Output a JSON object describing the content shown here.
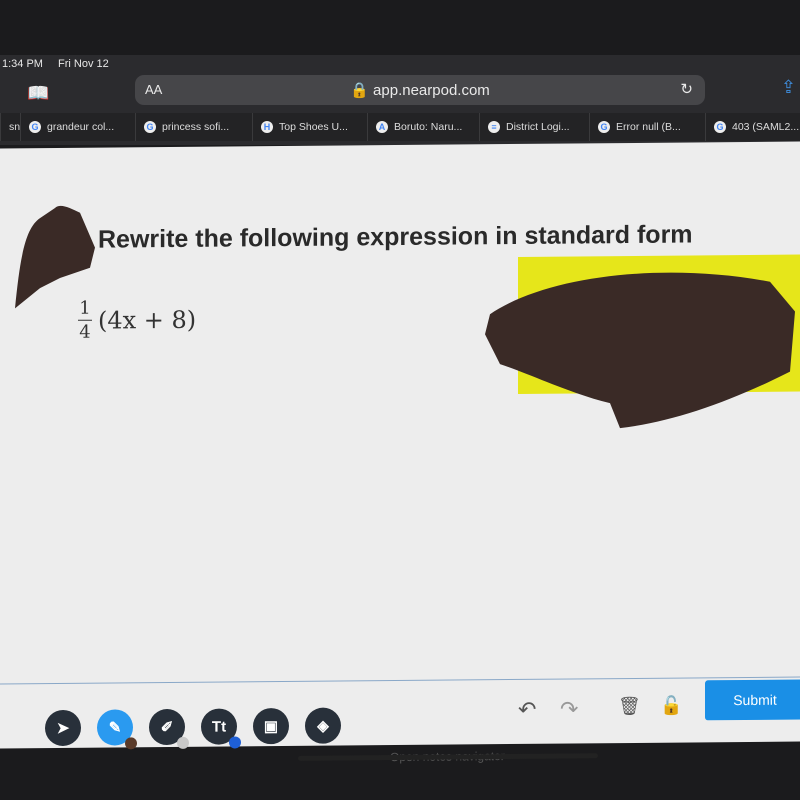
{
  "status_bar": {
    "time": "1:34 PM",
    "date": "Fri Nov 12"
  },
  "browser": {
    "text_size_label": "AA",
    "url": "app.nearpod.com",
    "icons": {
      "bookmarks": "book-icon",
      "lock": "lock-icon",
      "reload": "reload-icon",
      "share": "share-icon"
    },
    "tabs": [
      {
        "label": "sn",
        "icon": ""
      },
      {
        "label": "grandeur col...",
        "icon": "G"
      },
      {
        "label": "princess sofi...",
        "icon": "G"
      },
      {
        "label": "Top Shoes U...",
        "icon": "H"
      },
      {
        "label": "Boruto: Naru...",
        "icon": "A"
      },
      {
        "label": "District Logi...",
        "icon": "≡"
      },
      {
        "label": "Error null (B...",
        "icon": "G"
      },
      {
        "label": "403 (SAML2...",
        "icon": "G"
      }
    ]
  },
  "question": {
    "title": "Rewrite the following expression in standard form",
    "fraction_numerator": "1",
    "fraction_denominator": "4",
    "expression": "(4x + 8)"
  },
  "toolbar": {
    "tools": [
      {
        "name": "select",
        "icon": "cursor-icon",
        "glyph": "➤"
      },
      {
        "name": "pen",
        "icon": "pencil-icon",
        "glyph": "✎",
        "active": true,
        "color": "#5a3b2a"
      },
      {
        "name": "highlighter",
        "icon": "highlighter-icon",
        "glyph": "✐",
        "color": "#c8c8c8"
      },
      {
        "name": "text",
        "icon": "text-icon",
        "glyph": "Tt",
        "color": "#1e5fd6"
      },
      {
        "name": "image",
        "icon": "image-icon",
        "glyph": "▣"
      },
      {
        "name": "eraser",
        "icon": "eraser-icon",
        "glyph": "◈"
      }
    ],
    "undo": "↶",
    "redo": "↷",
    "trash": "🗑",
    "unlock": "🔓",
    "submit_label": "Submit",
    "notes_label": "Open notes navigator"
  },
  "colors": {
    "accent": "#1a8fe6",
    "active_tool": "#2a9af0",
    "highlight": "#e6e61a",
    "scribble": "#3a2a26"
  }
}
